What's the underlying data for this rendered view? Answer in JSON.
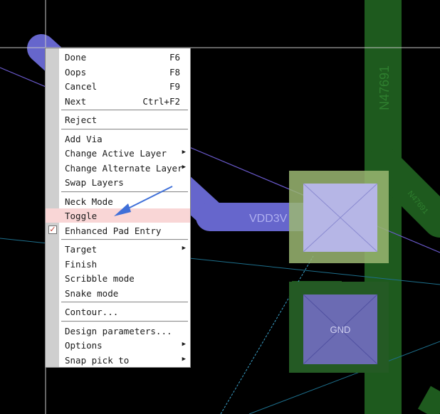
{
  "canvas": {
    "nets": {
      "vdd": "VDD3V",
      "gnd": "GND",
      "trace_label_vertical": "N47691",
      "trace_label_diagonal": "N47691"
    },
    "colors": {
      "background": "#000000",
      "trace_blue": "#6666cc",
      "trace_green": "#1e5a1e",
      "pad_top_fill": "#b6b6e6",
      "pad_top_outline": "#b9d48a",
      "pad_bottom_fill": "#6b6bb3",
      "crosshair": "#c8c8c8"
    }
  },
  "context_menu": {
    "items": [
      {
        "label": "Done",
        "shortcut": "F6",
        "submenu": false,
        "checked": false,
        "highlighted": false
      },
      {
        "label": "Oops",
        "shortcut": "F8",
        "submenu": false,
        "checked": false,
        "highlighted": false
      },
      {
        "label": "Cancel",
        "shortcut": "F9",
        "submenu": false,
        "checked": false,
        "highlighted": false
      },
      {
        "label": "Next",
        "shortcut": "Ctrl+F2",
        "submenu": false,
        "checked": false,
        "highlighted": false
      },
      {
        "separator": true
      },
      {
        "label": "Reject",
        "shortcut": "",
        "submenu": false,
        "checked": false,
        "highlighted": false
      },
      {
        "separator": true
      },
      {
        "label": "Add Via",
        "shortcut": "",
        "submenu": false,
        "checked": false,
        "highlighted": false
      },
      {
        "label": "Change Active Layer",
        "shortcut": "",
        "submenu": true,
        "checked": false,
        "highlighted": false
      },
      {
        "label": "Change Alternate Layer",
        "shortcut": "",
        "submenu": true,
        "checked": false,
        "highlighted": false
      },
      {
        "label": "Swap Layers",
        "shortcut": "",
        "submenu": false,
        "checked": false,
        "highlighted": false
      },
      {
        "separator": true
      },
      {
        "label": "Neck Mode",
        "shortcut": "",
        "submenu": false,
        "checked": false,
        "highlighted": false
      },
      {
        "label": "Toggle",
        "shortcut": "",
        "submenu": false,
        "checked": false,
        "highlighted": true
      },
      {
        "label": "Enhanced Pad Entry",
        "shortcut": "",
        "submenu": false,
        "checked": true,
        "highlighted": false
      },
      {
        "separator": true
      },
      {
        "label": "Target",
        "shortcut": "",
        "submenu": true,
        "checked": false,
        "highlighted": false
      },
      {
        "label": "Finish",
        "shortcut": "",
        "submenu": false,
        "checked": false,
        "highlighted": false
      },
      {
        "label": "Scribble mode",
        "shortcut": "",
        "submenu": false,
        "checked": false,
        "highlighted": false
      },
      {
        "label": "Snake mode",
        "shortcut": "",
        "submenu": false,
        "checked": false,
        "highlighted": false
      },
      {
        "separator": true
      },
      {
        "label": "Contour...",
        "shortcut": "",
        "submenu": false,
        "checked": false,
        "highlighted": false
      },
      {
        "separator": true
      },
      {
        "label": "Design parameters...",
        "shortcut": "",
        "submenu": false,
        "checked": false,
        "highlighted": false
      },
      {
        "label": "Options",
        "shortcut": "",
        "submenu": true,
        "checked": false,
        "highlighted": false
      },
      {
        "label": "Snap pick to",
        "shortcut": "",
        "submenu": true,
        "checked": false,
        "highlighted": false
      }
    ],
    "icons": {
      "submenu": "chevron-right-icon",
      "checked": "checkbox-checked-icon"
    }
  },
  "annotation": {
    "icon": "blue-arrow-icon",
    "color": "#3f6fd8"
  }
}
